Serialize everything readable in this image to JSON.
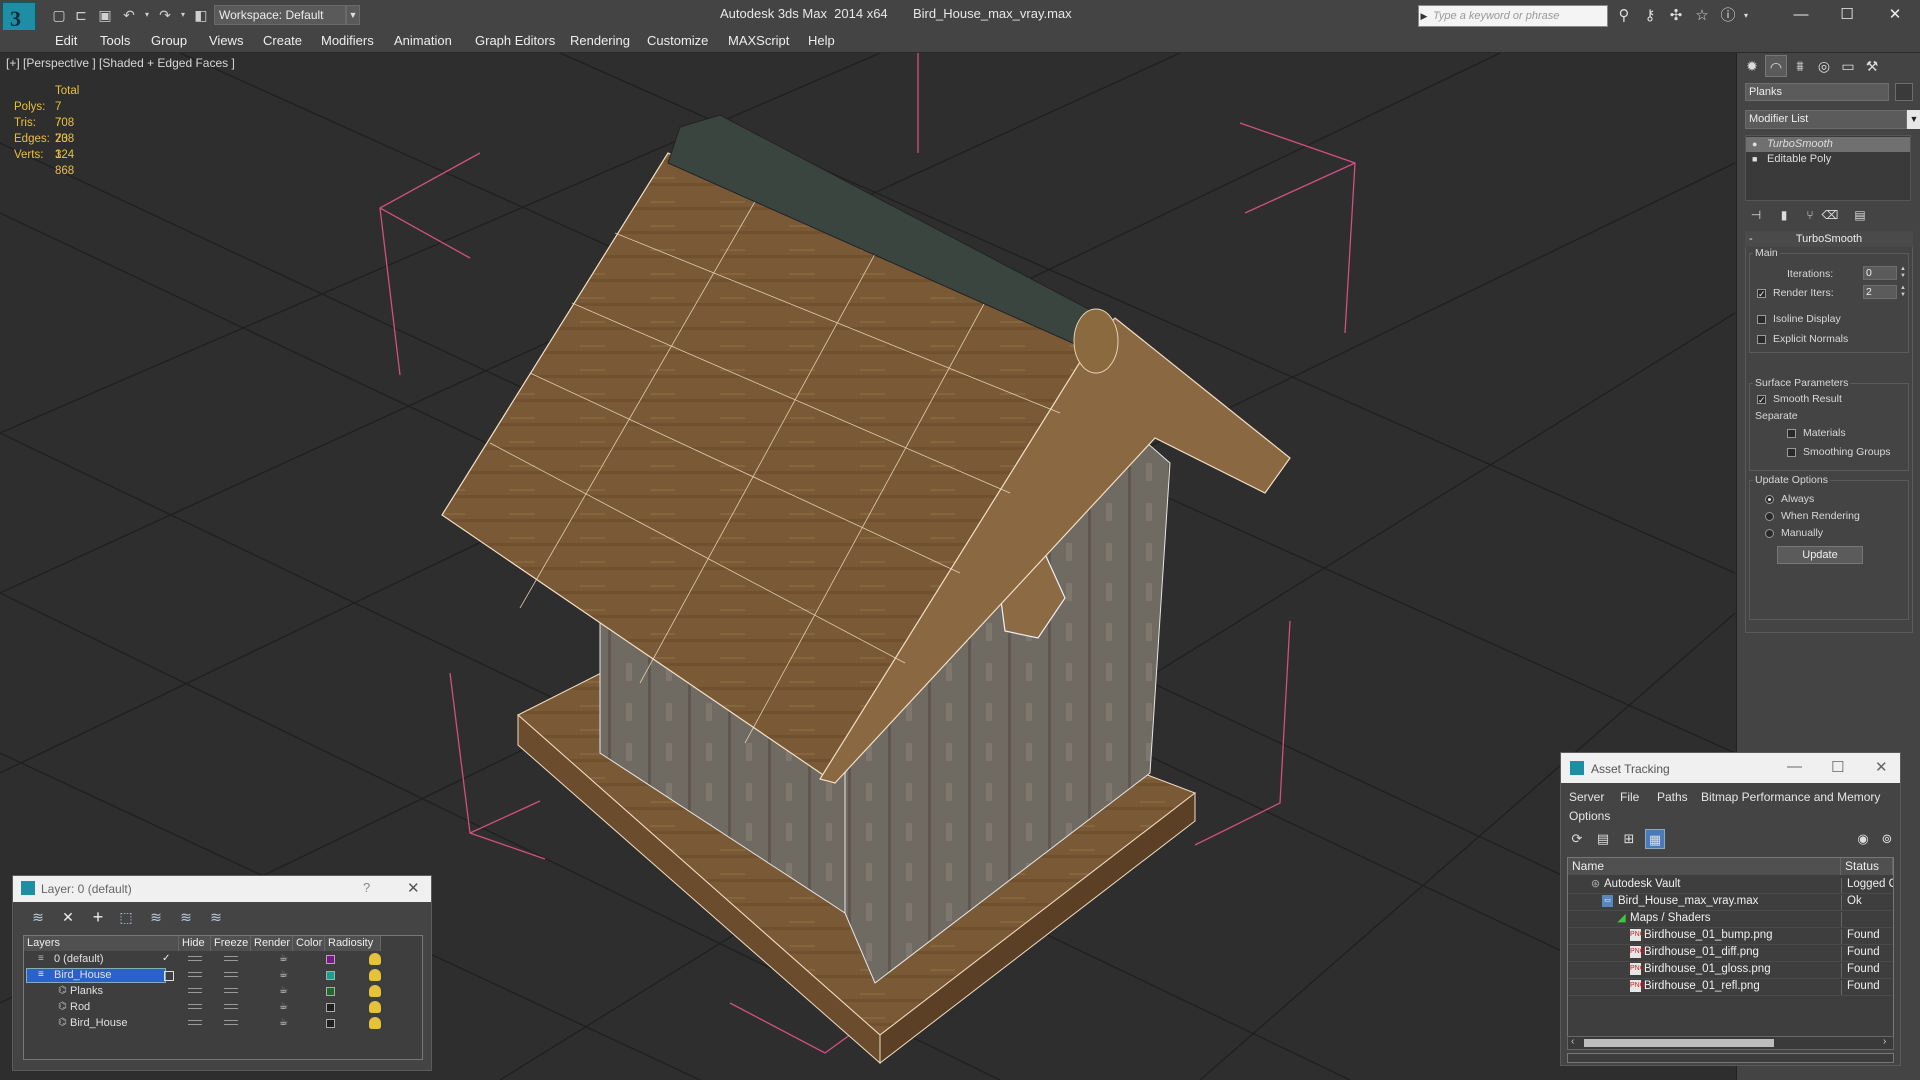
{
  "titlebar": {
    "app_title": "Autodesk 3ds Max  2014 x64       Bird_House_max_vray.max",
    "workspace": "Workspace: Default",
    "search_placeholder": "Type a keyword or phrase"
  },
  "menu": [
    "Edit",
    "Tools",
    "Group",
    "Views",
    "Create",
    "Modifiers",
    "Animation",
    "Graph Editors",
    "Rendering",
    "Customize",
    "MAXScript",
    "Help"
  ],
  "viewport": {
    "label": "[+] [Perspective ] [Shaded + Edged Faces ]",
    "stats_header": "Total",
    "stats": [
      {
        "key": "Polys:",
        "value": "7 708"
      },
      {
        "key": "Tris:",
        "value": "7 708"
      },
      {
        "key": "Edges:",
        "value": "23 124"
      },
      {
        "key": "Verts:",
        "value": "3 868"
      }
    ]
  },
  "command_panel": {
    "object_name": "Planks",
    "modifier_list": "Modifier List",
    "stack": [
      "TurboSmooth",
      "Editable Poly"
    ],
    "rollout_title": "TurboSmooth",
    "main_label": "Main",
    "iterations_label": "Iterations:",
    "iterations_value": "0",
    "render_iters_label": "Render Iters:",
    "render_iters_value": "2",
    "isoline_label": "Isoline Display",
    "explicit_normals_label": "Explicit Normals",
    "surface_params_label": "Surface Parameters",
    "smooth_result_label": "Smooth Result",
    "separate_label": "Separate",
    "materials_label": "Materials",
    "smoothing_groups_label": "Smoothing Groups",
    "update_options_label": "Update Options",
    "always_label": "Always",
    "when_rendering_label": "When Rendering",
    "manually_label": "Manually",
    "update_button": "Update"
  },
  "layer_dialog": {
    "title": "Layer: 0 (default)",
    "help": "?",
    "columns": [
      "Layers",
      "Hide",
      "Freeze",
      "Render",
      "Color",
      "Radiosity"
    ],
    "rows": [
      {
        "name": "0 (default)",
        "color": "#7a1a8a",
        "check": "✓"
      },
      {
        "name": "Bird_House",
        "color": "#1aa090",
        "check": ""
      },
      {
        "name": "Planks",
        "color": "#1f6a2a",
        "check": ""
      },
      {
        "name": "Rod",
        "color": "#1f1f1f",
        "check": ""
      },
      {
        "name": "Bird_House",
        "color": "#1f1f1f",
        "check": ""
      }
    ]
  },
  "asset_dialog": {
    "title": "Asset Tracking",
    "menu": [
      "Server",
      "File",
      "Paths",
      "Bitmap Performance and Memory"
    ],
    "menu_row2": "Options",
    "columns": [
      "Name",
      "Status"
    ],
    "rows": [
      {
        "name": "Autodesk Vault",
        "status": "Logged Ou"
      },
      {
        "name": "Bird_House_max_vray.max",
        "status": "Ok"
      },
      {
        "name": "Maps / Shaders",
        "status": ""
      },
      {
        "name": "Birdhouse_01_bump.png",
        "status": "Found"
      },
      {
        "name": "Birdhouse_01_diff.png",
        "status": "Found"
      },
      {
        "name": "Birdhouse_01_gloss.png",
        "status": "Found"
      },
      {
        "name": "Birdhouse_01_refl.png",
        "status": "Found"
      }
    ]
  }
}
